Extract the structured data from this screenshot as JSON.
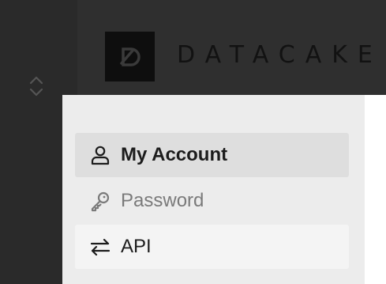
{
  "brand": {
    "name": "DATACAKE",
    "logo_icon": "datacake-logo-icon"
  },
  "workspace_switcher": {
    "icon": "chevron-up-down-icon"
  },
  "menu": {
    "items": [
      {
        "label": "My Account",
        "icon": "user-icon",
        "state": "active"
      },
      {
        "label": "Password",
        "icon": "key-icon",
        "state": "hover"
      },
      {
        "label": "API",
        "icon": "arrows-exchange-icon",
        "state": "normal"
      }
    ]
  },
  "colors": {
    "sidebar_bg": "#2a2a2a",
    "topbar_bg": "#2f2f2f",
    "menu_bg": "#ececec",
    "active_item_bg": "#dedede",
    "logo_bg": "#0e0e0e"
  }
}
